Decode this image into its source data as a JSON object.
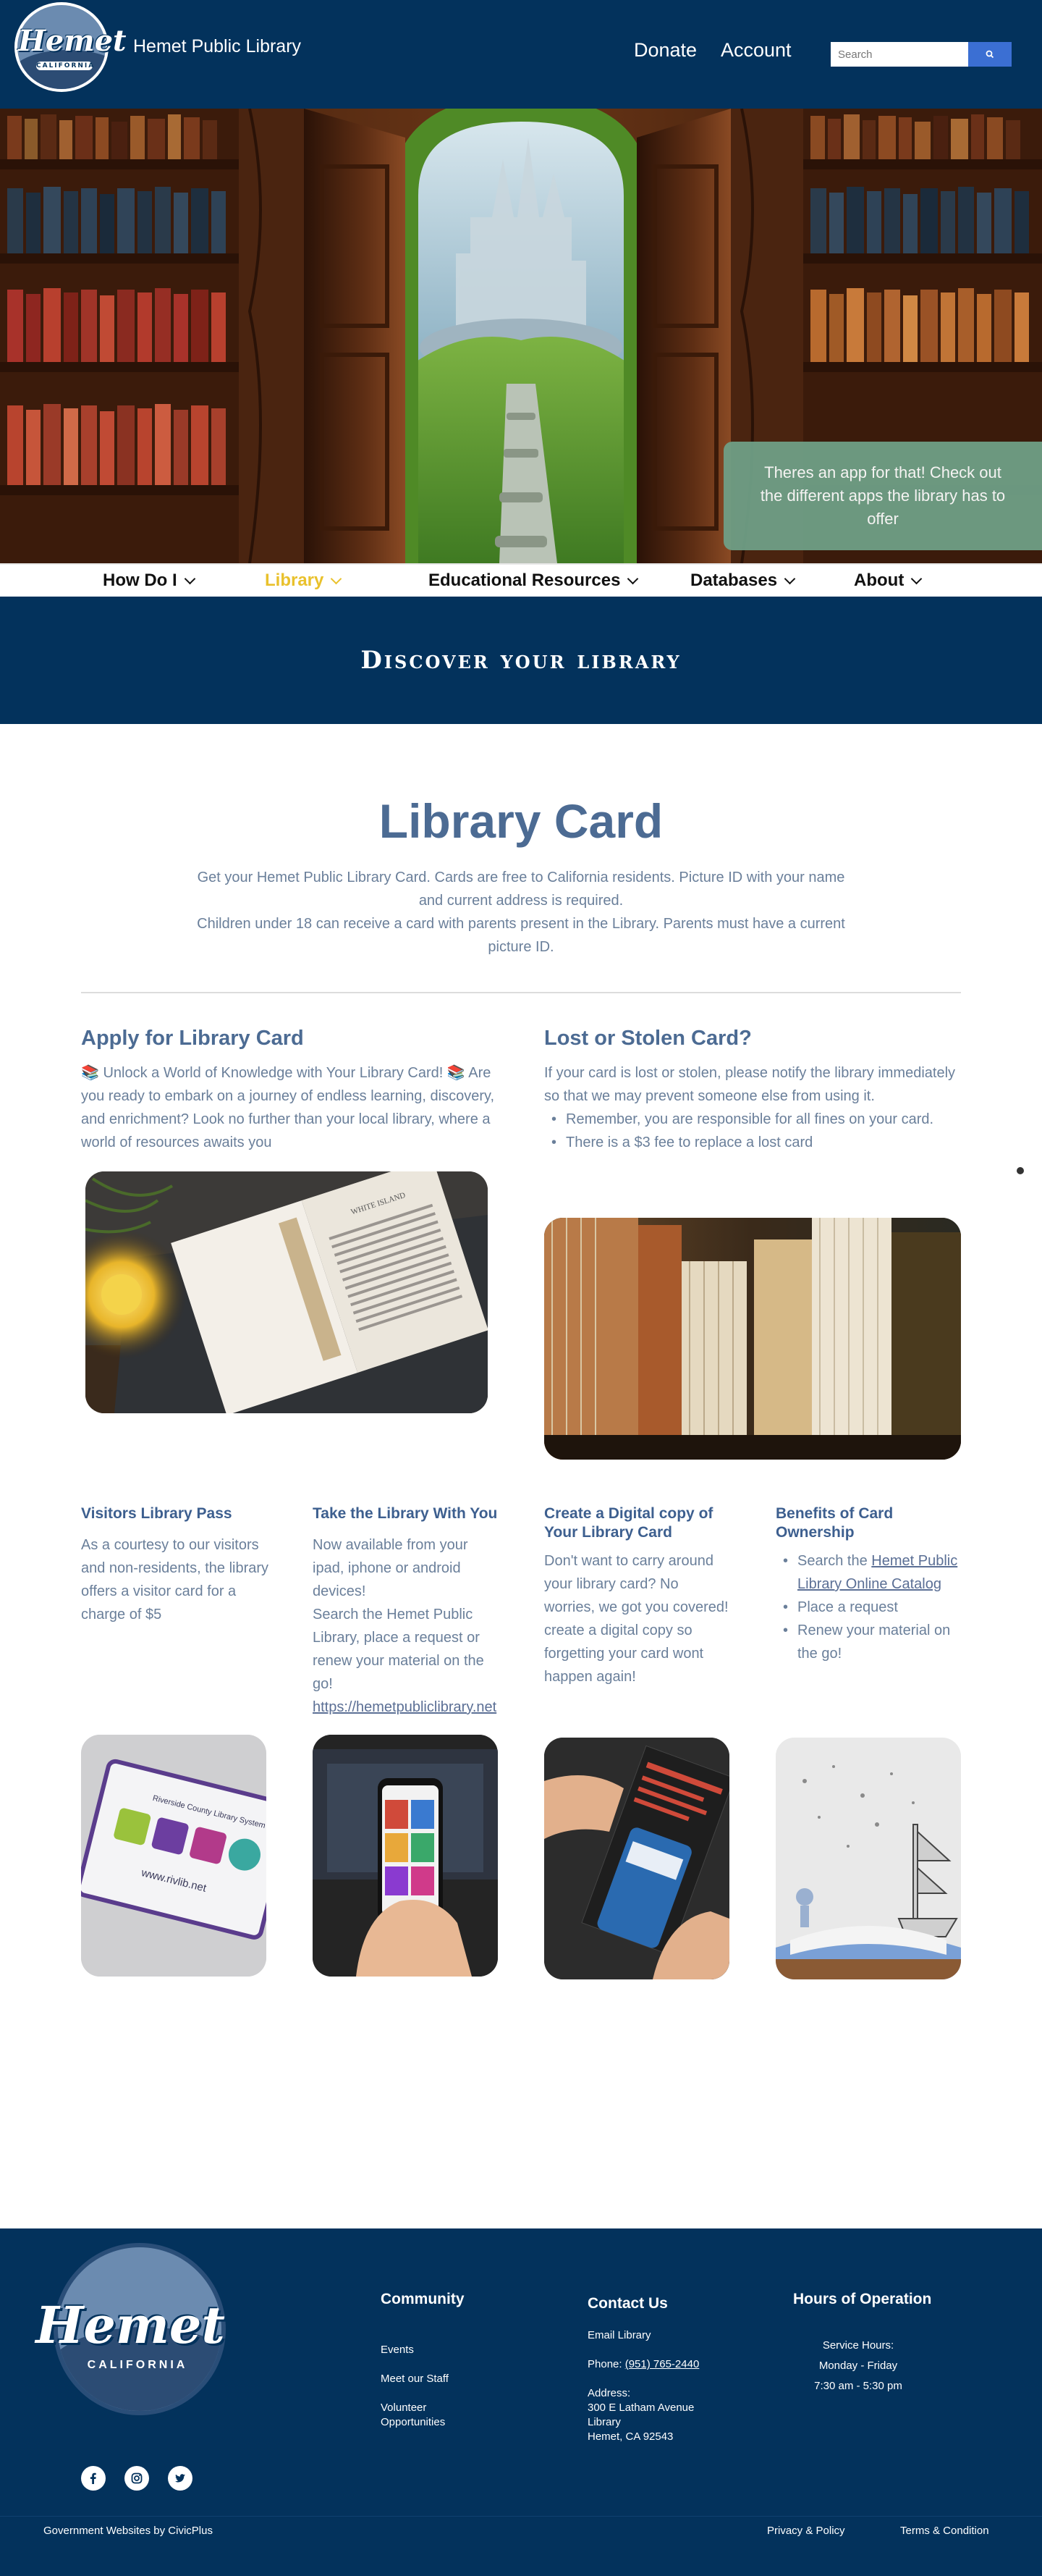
{
  "header": {
    "logo_word": "Hemet",
    "logo_sub": "CALIFORNIA",
    "site_name": "Hemet Public Library",
    "nav": {
      "donate": "Donate",
      "account": "Account"
    },
    "search": {
      "placeholder": "Search"
    }
  },
  "hero": {
    "app_callout": "Theres an app for that! Check out the different apps the library has to offer"
  },
  "mainnav": {
    "items": [
      {
        "label": "How Do I",
        "active": false
      },
      {
        "label": "Library",
        "active": true
      },
      {
        "label": "Educational Resources",
        "active": false
      },
      {
        "label": "Databases",
        "active": false
      },
      {
        "label": "About",
        "active": false
      }
    ]
  },
  "banner": {
    "title": "Discover your library"
  },
  "main": {
    "title": "Library Card",
    "intro_1": "Get your Hemet Public Library Card. Cards are free to California residents. Picture ID with your name and current address is required.",
    "intro_2": "Children under 18 can receive a card with parents present in the Library. Parents must have a current picture ID.",
    "apply": {
      "title": "Apply for Library Card",
      "text": "📚 Unlock a World of Knowledge with Your Library Card! 📚 Are you ready to embark on a journey of endless learning, discovery, and enrichment? Look no further than your local library, where a world of resources awaits you"
    },
    "lost": {
      "title": "Lost or Stolen Card?",
      "text": "If your card is lost or stolen, please notify the library immediately so that we may prevent someone else from using it.",
      "bullets": [
        "Remember, you are responsible for all fines on your card.",
        "There is a $3 fee to replace a lost card"
      ]
    },
    "cards": {
      "visitor": {
        "title": "Visitors Library Pass",
        "text": "As a courtesy to our visitors and non-residents, the library offers a visitor card for a charge of $5"
      },
      "take": {
        "title": "Take the Library With You",
        "text_1": "Now available from your ipad, iphone or android devices!",
        "text_2": "Search the Hemet Public Library, place a request or renew your material on the go!",
        "link": "https://hemetpubliclibrary.net"
      },
      "digital": {
        "title": "Create a Digital copy of Your Library Card",
        "text": "Don't want to carry around your library card? No worries, we got you covered! create a digital copy so forgetting your card wont happen again!"
      },
      "benefits": {
        "title": "Benefits of Card Ownership",
        "bullet_1_prefix": "Search the ",
        "bullet_1_link": "Hemet Public Library Online Catalog",
        "bullet_2": "Place a request",
        "bullet_3": "Renew your material on the go!"
      }
    },
    "image_text": {
      "book_page": "WHITE ISLAND",
      "rcls_card_title": "Riverside County Library System",
      "rcls_card_url": "www.rivlib.net"
    }
  },
  "footer": {
    "logo_word": "Hemet",
    "logo_sub": "CALIFORNIA",
    "community": {
      "title": "Community",
      "links": [
        "Events",
        "Meet our Staff",
        "Volunteer Opportunities"
      ]
    },
    "contact": {
      "title": "Contact Us",
      "email": "Email Library",
      "phone_label": "Phone: ",
      "phone": "(951) 765-2440",
      "address_label": "Address:",
      "address_1": "300 E Latham Avenue",
      "address_2": "Library",
      "address_3": "Hemet, CA 92543"
    },
    "hours": {
      "title": "Hours of Operation",
      "line_1": "Service Hours:",
      "line_2": "Monday - Friday",
      "line_3": "7:30 am - 5:30 pm"
    },
    "social": [
      "facebook-icon",
      "instagram-icon",
      "twitter-icon"
    ],
    "credit": "Government Websites by CivicPlus",
    "privacy": "Privacy & Policy",
    "terms": "Terms & Condition"
  },
  "colors": {
    "navy": "#03325c",
    "accent_gold": "#e9c12c",
    "search_blue": "#3b6fd3",
    "callout_green": "#6f9f86",
    "heading_blue": "#4c6b93"
  }
}
